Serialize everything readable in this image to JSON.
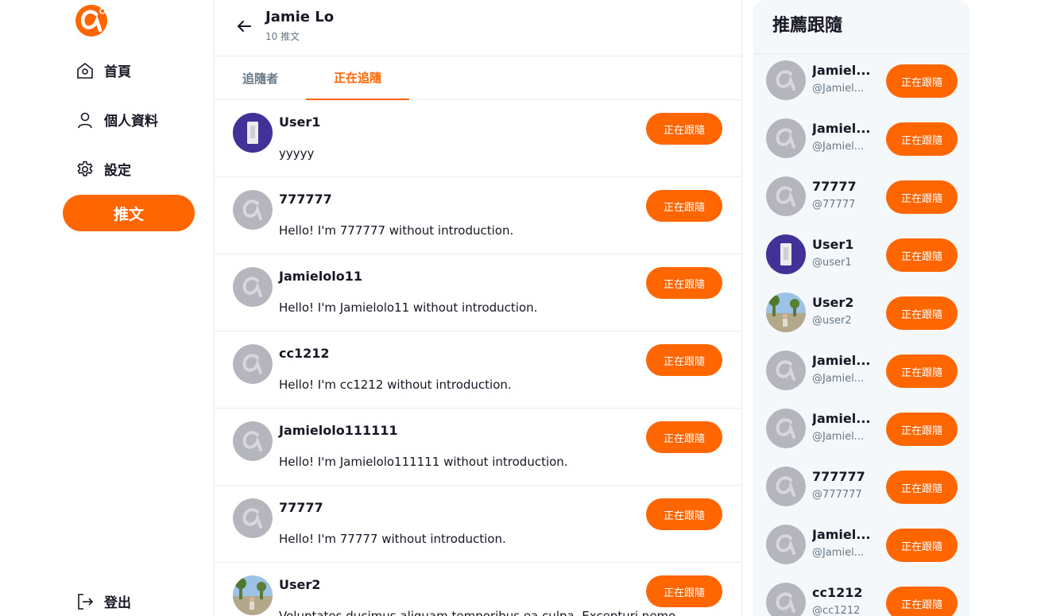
{
  "sidebar": {
    "nav": [
      {
        "label": "首頁",
        "icon": "home-icon"
      },
      {
        "label": "個人資料",
        "icon": "user-icon"
      },
      {
        "label": "設定",
        "icon": "gear-icon"
      }
    ],
    "tweet_label": "推文",
    "logout_label": "登出"
  },
  "header": {
    "name": "Jamie Lo",
    "tweet_count": "10 推文"
  },
  "tabs": [
    {
      "label": "追隨者",
      "active": false
    },
    {
      "label": "正在追隨",
      "active": true
    }
  ],
  "following": [
    {
      "name": "User1",
      "bio": "yyyyy",
      "avatar": "user1",
      "button": "正在跟隨"
    },
    {
      "name": "777777",
      "bio": "Hello! I'm 777777 without introduction.",
      "avatar": "default",
      "button": "正在跟隨"
    },
    {
      "name": "Jamielolo11",
      "bio": "Hello! I'm Jamielolo11 without introduction.",
      "avatar": "default",
      "button": "正在跟隨"
    },
    {
      "name": "cc1212",
      "bio": "Hello! I'm cc1212 without introduction.",
      "avatar": "default",
      "button": "正在跟隨"
    },
    {
      "name": "Jamielolo111111",
      "bio": "Hello! I'm Jamielolo111111 without introduction.",
      "avatar": "default",
      "button": "正在跟隨"
    },
    {
      "name": "77777",
      "bio": "Hello! I'm 77777 without introduction.",
      "avatar": "default",
      "button": "正在跟隨"
    },
    {
      "name": "User2",
      "bio": "Voluptates ducimus aliquam temporibus ea culpa. Excepturi nemo",
      "avatar": "user2",
      "button": "正在跟隨"
    }
  ],
  "recommend": {
    "title": "推薦跟隨",
    "users": [
      {
        "name": "Jamiel...",
        "handle": "@Jamiel...",
        "avatar": "default",
        "button": "正在跟隨"
      },
      {
        "name": "Jamiel...",
        "handle": "@Jamiel...",
        "avatar": "default",
        "button": "正在跟隨"
      },
      {
        "name": "77777",
        "handle": "@77777",
        "avatar": "default",
        "button": "正在跟隨"
      },
      {
        "name": "User1",
        "handle": "@user1",
        "avatar": "user1",
        "button": "正在跟隨"
      },
      {
        "name": "User2",
        "handle": "@user2",
        "avatar": "user2",
        "button": "正在跟隨"
      },
      {
        "name": "Jamiel...",
        "handle": "@Jamiel...",
        "avatar": "default",
        "button": "正在跟隨"
      },
      {
        "name": "Jamiel...",
        "handle": "@Jamiel...",
        "avatar": "default",
        "button": "正在跟隨"
      },
      {
        "name": "777777",
        "handle": "@777777",
        "avatar": "default",
        "button": "正在跟隨"
      },
      {
        "name": "Jamiel...",
        "handle": "@Jamiel...",
        "avatar": "default",
        "button": "正在跟隨"
      },
      {
        "name": "cc1212",
        "handle": "@cc1212",
        "avatar": "default",
        "button": "正在跟隨"
      }
    ]
  },
  "colors": {
    "accent": "#ff6600",
    "text": "#171725",
    "secondary": "#657786",
    "border": "#e6ecf0",
    "panel": "#f5f8fa"
  }
}
